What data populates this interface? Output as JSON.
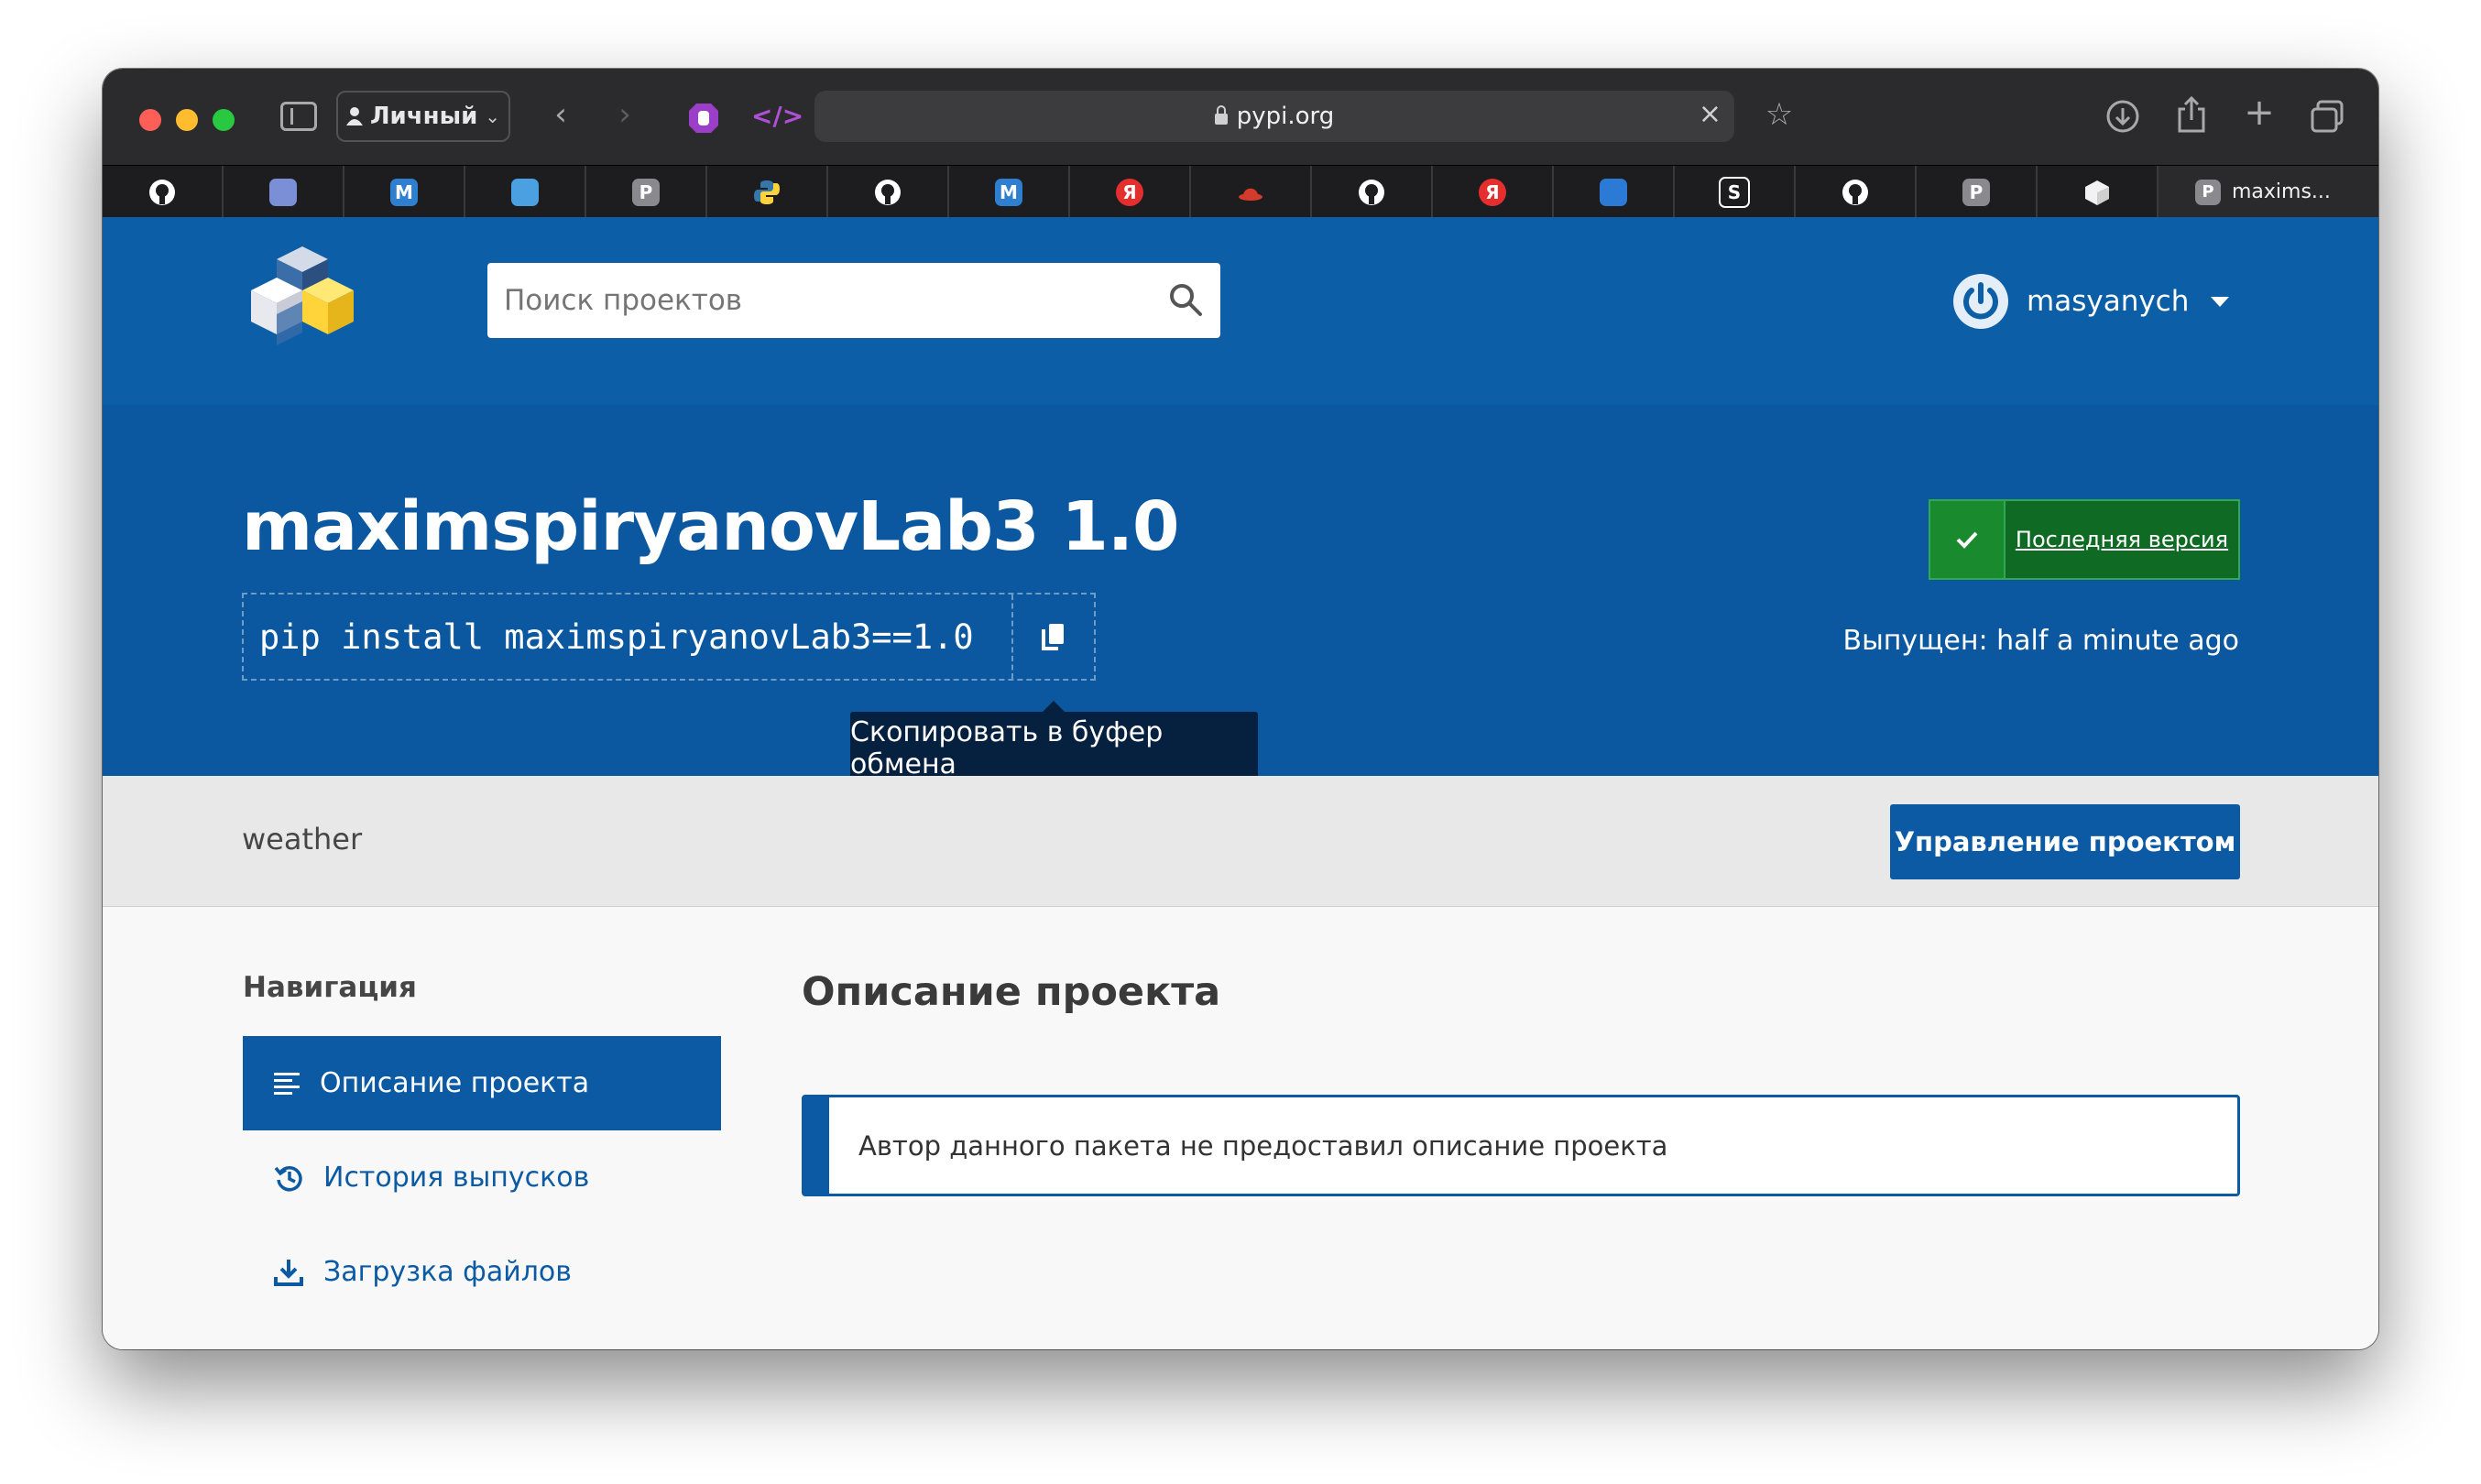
{
  "browser": {
    "profile_label": "Личный",
    "address": "pypi.org",
    "active_tab_letter": "P",
    "active_tab_label": "maxims...",
    "bookmarks": [
      {
        "icon": "github-icon",
        "letter": "",
        "color": "#1d1d1f"
      },
      {
        "icon": "site-icon",
        "letter": "",
        "color": "#7b8fd6"
      },
      {
        "icon": "m-icon",
        "letter": "M",
        "color": "#2f7fd1"
      },
      {
        "icon": "docker-icon",
        "letter": "",
        "color": "#4aa0e0"
      },
      {
        "icon": "p-icon",
        "letter": "P",
        "color": "#8a8a8e"
      },
      {
        "icon": "python-icon",
        "letter": "",
        "color": "#3776ab"
      },
      {
        "icon": "github-icon",
        "letter": "",
        "color": "#1d1d1f"
      },
      {
        "icon": "m-icon",
        "letter": "M",
        "color": "#2f7fd1"
      },
      {
        "icon": "yandex-icon",
        "letter": "Я",
        "color": "#e52e2e"
      },
      {
        "icon": "hat-icon",
        "letter": "",
        "color": "#d33b2c"
      },
      {
        "icon": "github-icon",
        "letter": "",
        "color": "#1d1d1f"
      },
      {
        "icon": "yandex-icon",
        "letter": "Я",
        "color": "#e52e2e"
      },
      {
        "icon": "gear-icon",
        "letter": "",
        "color": "#2b7bd6"
      },
      {
        "icon": "s-icon",
        "letter": "S",
        "color": "#1d1d1f"
      },
      {
        "icon": "github-icon",
        "letter": "",
        "color": "#1d1d1f"
      },
      {
        "icon": "p-icon",
        "letter": "P",
        "color": "#8a8a8e"
      },
      {
        "icon": "cube-icon",
        "letter": "",
        "color": "#e8e8e8"
      }
    ]
  },
  "header": {
    "search_placeholder": "Поиск проектов",
    "username": "masyanych"
  },
  "package": {
    "title": "maximspiryanovLab3 1.0",
    "pip_command": "pip install maximspiryanovLab3==1.0",
    "copy_tooltip": "Скопировать в буфер обмена",
    "latest_label": "Последняя версия",
    "released_label": "Выпущен:",
    "released_value": "half a minute ago",
    "summary": "weather",
    "manage_label": "Управление проектом"
  },
  "nav": {
    "title": "Навигация",
    "items": [
      {
        "label": "Описание проекта",
        "active": true
      },
      {
        "label": "История выпусков",
        "active": false
      },
      {
        "label": "Загрузка файлов",
        "active": false
      }
    ]
  },
  "main": {
    "section_title": "Описание проекта",
    "notice": "Автор данного пакета не предоставил описание проекта"
  },
  "colors": {
    "header_blue": "#0c5ea6",
    "banner_blue": "#0b58a0",
    "accent_blue": "#0b5aa3",
    "latest_green": "#0f6b24"
  }
}
